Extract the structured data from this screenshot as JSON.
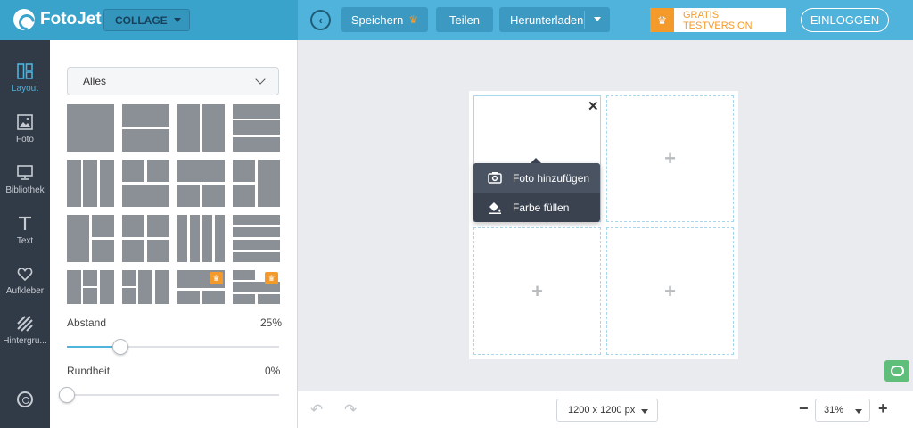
{
  "app": {
    "logo_text": "FotoJet",
    "mode_label": "COLLAGE"
  },
  "header": {
    "save_label": "Speichern",
    "share_label": "Teilen",
    "download_label": "Herunterladen",
    "trial_label": "GRATIS TESTVERSION",
    "login_label": "EINLOGGEN"
  },
  "sidebar": {
    "items": [
      {
        "label": "Layout",
        "icon": "layout-icon",
        "active": true
      },
      {
        "label": "Foto",
        "icon": "photo-icon"
      },
      {
        "label": "Bibliothek",
        "icon": "library-icon"
      },
      {
        "label": "Text",
        "icon": "text-icon"
      },
      {
        "label": "Aufkleber",
        "icon": "heart-icon"
      },
      {
        "label": "Hintergru...",
        "icon": "background-icon"
      }
    ],
    "settings_icon": "gear-icon"
  },
  "panel": {
    "filter_value": "Alles",
    "spacing": {
      "label": "Abstand",
      "value_text": "25%",
      "value": 0.25
    },
    "roundness": {
      "label": "Rundheit",
      "value_text": "0%",
      "value": 0
    }
  },
  "canvas": {
    "size_label": "1200 x 1200 px",
    "zoom_label": "31%",
    "context_menu": {
      "add_photo": "Foto hinzufügen",
      "fill_color": "Farbe füllen"
    }
  },
  "colors": {
    "accent": "#4fb3db",
    "pro": "#f39a2b",
    "rail": "#313a47",
    "thumb": "#8b9097"
  }
}
